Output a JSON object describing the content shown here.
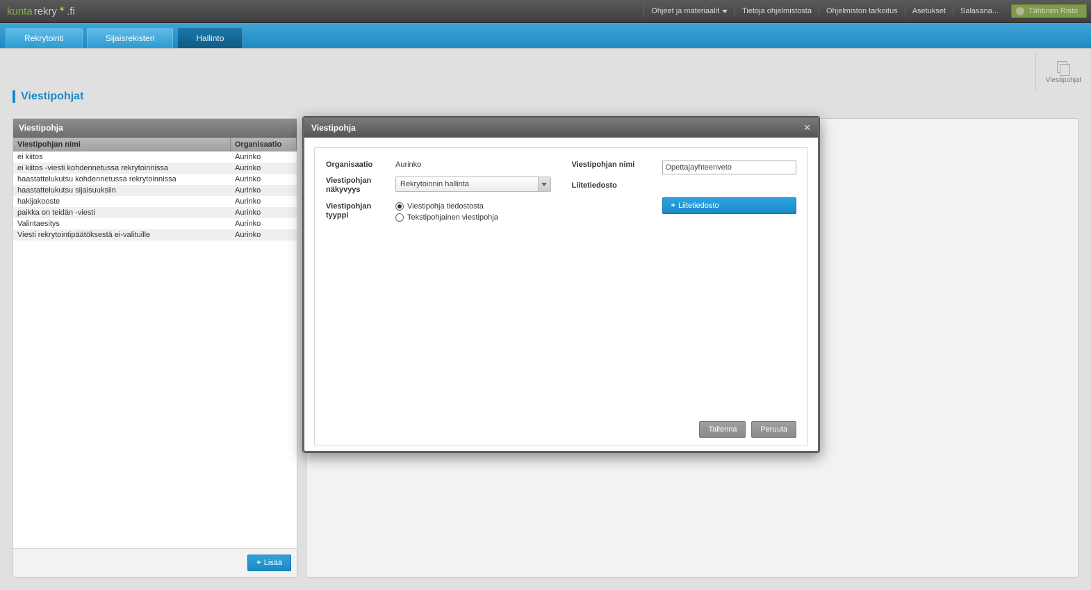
{
  "topbar": {
    "logo_part1": "kunta",
    "logo_part2": "rekry",
    "logo_part3": ".fi",
    "links": {
      "help": "Ohjeet ja materiaalit",
      "about": "Tietoja ohjelmistosta",
      "purpose": "Ohjelmiston tarkoitus",
      "settings": "Asetukset",
      "password": "Salasana..."
    },
    "user": "Tähtinen Risto"
  },
  "nav": {
    "tab1": "Rekrytointi",
    "tab2": "Sijaisrekisteri",
    "tab3": "Hallinto"
  },
  "side": {
    "templates": "Viestipohjat"
  },
  "page": {
    "title": "Viestipohjat"
  },
  "grid": {
    "panel_title": "Viestipohja",
    "col_name": "Viestipohjan nimi",
    "col_org": "Organisaatio",
    "rows": [
      {
        "name": "ei kiitos",
        "org": "Aurinko"
      },
      {
        "name": "ei kiitos -viesti kohdennetussa rekrytoinnissa",
        "org": "Aurinko"
      },
      {
        "name": "haastattelukutsu kohdennetussa rekrytoinnissa",
        "org": "Aurinko"
      },
      {
        "name": "haastattelukutsu sijaisuuksiin",
        "org": "Aurinko"
      },
      {
        "name": "hakijakooste",
        "org": "Aurinko"
      },
      {
        "name": "paikka on teidän -viesti",
        "org": "Aurinko"
      },
      {
        "name": "Valintaesitys",
        "org": "Aurinko"
      },
      {
        "name": "Viesti rekrytointipäätöksestä ei-valituille",
        "org": "Aurinko"
      }
    ],
    "add_label": "Lisää"
  },
  "modal": {
    "title": "Viestipohja",
    "labels": {
      "org": "Organisaatio",
      "visibility": "Viestipohjan näkyvyys",
      "type": "Viestipohjan tyyppi",
      "name": "Viestipohjan nimi",
      "attachment": "Liitetiedosto"
    },
    "values": {
      "org": "Aurinko",
      "visibility_selected": "Rekrytoinnin hallinta",
      "type_options": {
        "file": "Viestipohja tiedostosta",
        "text": "Tekstipohjainen viestipohja"
      },
      "name": "Opettajayhteenveto"
    },
    "buttons": {
      "attachment": "Liitetiedosto",
      "save": "Tallenna",
      "cancel": "Peruuta"
    }
  }
}
